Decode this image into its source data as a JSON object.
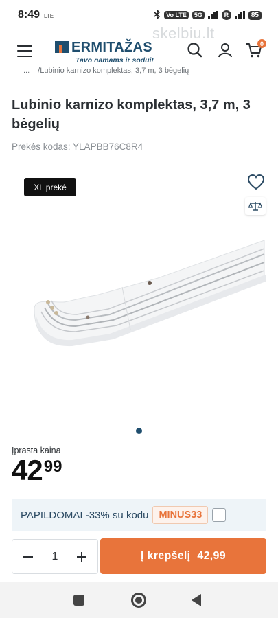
{
  "status_bar": {
    "time": "8:49",
    "lte_label": "LTE",
    "volte_label": "Vo LTE",
    "network_label": "5G",
    "roaming_label": "R",
    "battery_label": "85"
  },
  "watermark": "skelbiu.lt",
  "header": {
    "logo_text": "ERMITAŽAS",
    "logo_tagline": "Tavo namams ir sodui!",
    "cart_count": "0"
  },
  "breadcrumb": {
    "ellipsis": "...",
    "current": "/Lubinio karnizo komplektas, 3,7 m, 3 bėgelių"
  },
  "product": {
    "title": "Lubinio karnizo komplektas, 3,7 m, 3 bėgelių",
    "sku_label": "Prekės kodas: YLAPBB76C8R4",
    "badge": "XL prekė",
    "price_label": "Įprasta kaina",
    "price_int": "42",
    "price_dec": "99"
  },
  "promo": {
    "text": "PAPILDOMAI -33% su kodu",
    "code": "MINUS33"
  },
  "cart": {
    "quantity": "1",
    "button_label": "Į krepšelį",
    "button_price": "42,99"
  },
  "colors": {
    "brand_blue": "#1f4e6e",
    "brand_orange": "#e8743b"
  }
}
